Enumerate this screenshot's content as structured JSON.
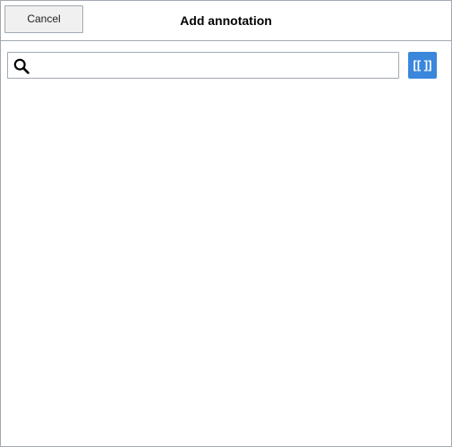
{
  "dialog": {
    "title": "Add annotation",
    "cancel_label": "Cancel"
  },
  "search": {
    "value": "",
    "placeholder": "",
    "icon": "search-icon"
  },
  "toolbar": {
    "wikitext_label": "[[ ]]",
    "wikitext_color": "#3a87dc"
  }
}
